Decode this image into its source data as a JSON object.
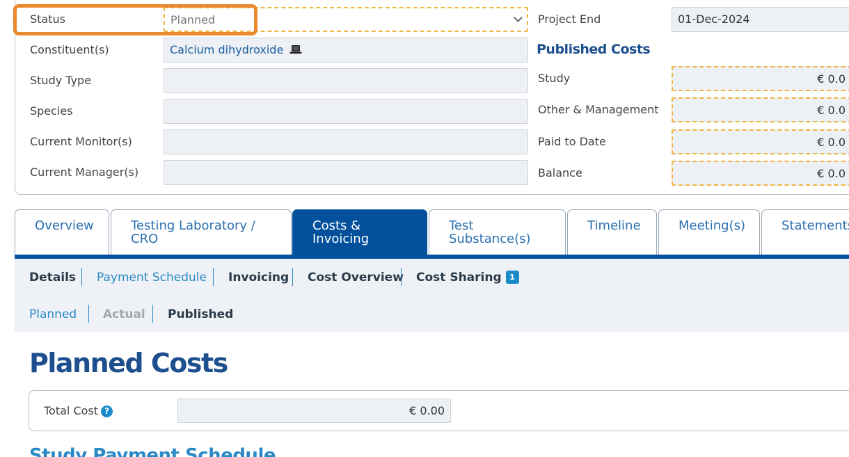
{
  "details": {
    "status_label": "Status",
    "status_value": "Planned",
    "constituents_label": "Constituent(s)",
    "constituents_value": "Calcium dihydroxide",
    "study_type_label": "Study Type",
    "species_label": "Species",
    "current_monitors_label": "Current Monitor(s)",
    "current_managers_label": "Current Manager(s)",
    "project_end_label": "Project End",
    "project_end_value": "01-Dec-2024"
  },
  "published_costs": {
    "heading": "Published Costs",
    "rows": [
      {
        "label": "Study",
        "value": "€ 0.0"
      },
      {
        "label": "Other & Management",
        "value": "€ 0.0"
      },
      {
        "label": "Paid to Date",
        "value": "€ 0.0"
      },
      {
        "label": "Balance",
        "value": "€ 0.0"
      }
    ]
  },
  "tabs": [
    {
      "line1": "Overview",
      "line2": ""
    },
    {
      "line1": "Testing Laboratory /",
      "line2": "CRO"
    },
    {
      "line1": "Costs &",
      "line2": "Invoicing"
    },
    {
      "line1": "Test",
      "line2": "Substance(s)"
    },
    {
      "line1": "Timeline",
      "line2": ""
    },
    {
      "line1": "Meeting(s)",
      "line2": ""
    },
    {
      "line1": "Statements",
      "line2": ""
    }
  ],
  "subnav": {
    "row1": [
      "Details",
      "Payment Schedule",
      "Invoicing",
      "Cost Overview",
      "Cost Sharing"
    ],
    "cost_sharing_badge": "1",
    "row2": [
      "Planned",
      "Actual",
      "Published"
    ]
  },
  "page": {
    "title": "Planned Costs",
    "total_cost_label": "Total Cost",
    "help_icon_glyph": "?",
    "total_cost_value": "€ 0.00",
    "next_section_title": "Study Payment Schedule"
  }
}
